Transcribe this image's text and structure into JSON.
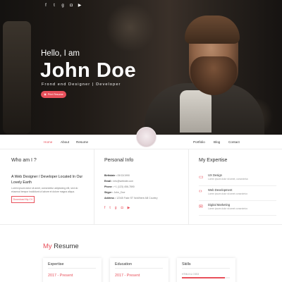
{
  "hero": {
    "social_icons": [
      "facebook-icon",
      "twitter-icon",
      "google-plus-icon",
      "instagram-icon",
      "youtube-icon"
    ],
    "greeting": "Hello, I am",
    "name": "John Doe",
    "role": "Frond end Designer | Developer",
    "print_button": "Print Resume"
  },
  "nav": {
    "left": [
      "Home",
      "About",
      "Resume"
    ],
    "right": [
      "Portfolio",
      "Blog",
      "Contact"
    ],
    "active": "Home"
  },
  "about": {
    "title": "Who am I ?",
    "lead": "A Web Designer / Developer Located In Our Lovely Earth",
    "text": "Lorem ipsum dolor sit amet, consectetur adipisicing elit, sed do eiusmod tempor incididunt ut labore et dolore magna aliqua.",
    "download_button": "Download My CV"
  },
  "personal": {
    "title": "Personal Info",
    "rows": [
      {
        "label": "Birthdate :",
        "value": "09/13/1990"
      },
      {
        "label": "Email :",
        "value": "info@website.com"
      },
      {
        "label": "Phone :",
        "value": "+1 (123) 456-7890"
      },
      {
        "label": "Skype :",
        "value": "John_Doe"
      },
      {
        "label": "Address :",
        "value": "12345 Fake ST NoWhere AB Country"
      }
    ],
    "social_icons": [
      "facebook-icon",
      "twitter-icon",
      "google-plus-icon",
      "instagram-icon",
      "youtube-icon"
    ]
  },
  "expertise": {
    "title": "My Expertise",
    "items": [
      {
        "icon": "ux-icon",
        "title": "UX Design",
        "desc": "Lorem ipsum dolor sit amet, consectetur."
      },
      {
        "icon": "code-icon",
        "title": "Web Development",
        "desc": "Lorem ipsum dolor sit amet consectetur."
      },
      {
        "icon": "marketing-icon",
        "title": "Digital Marketing",
        "desc": "Lorem ipsum dolor sit amet consectetur."
      }
    ]
  },
  "resume": {
    "title_accent": "My",
    "title_rest": " Resume",
    "cards": [
      {
        "title": "Expertise",
        "year": "2017 - Present"
      },
      {
        "title": "Education",
        "year": "2017 - Present"
      },
      {
        "title": "Skills",
        "skill": "HTML5 & CSS3",
        "level": 0.9
      }
    ]
  },
  "colors": {
    "accent": "#e8505b",
    "hero_dark": "#1f1a16"
  }
}
